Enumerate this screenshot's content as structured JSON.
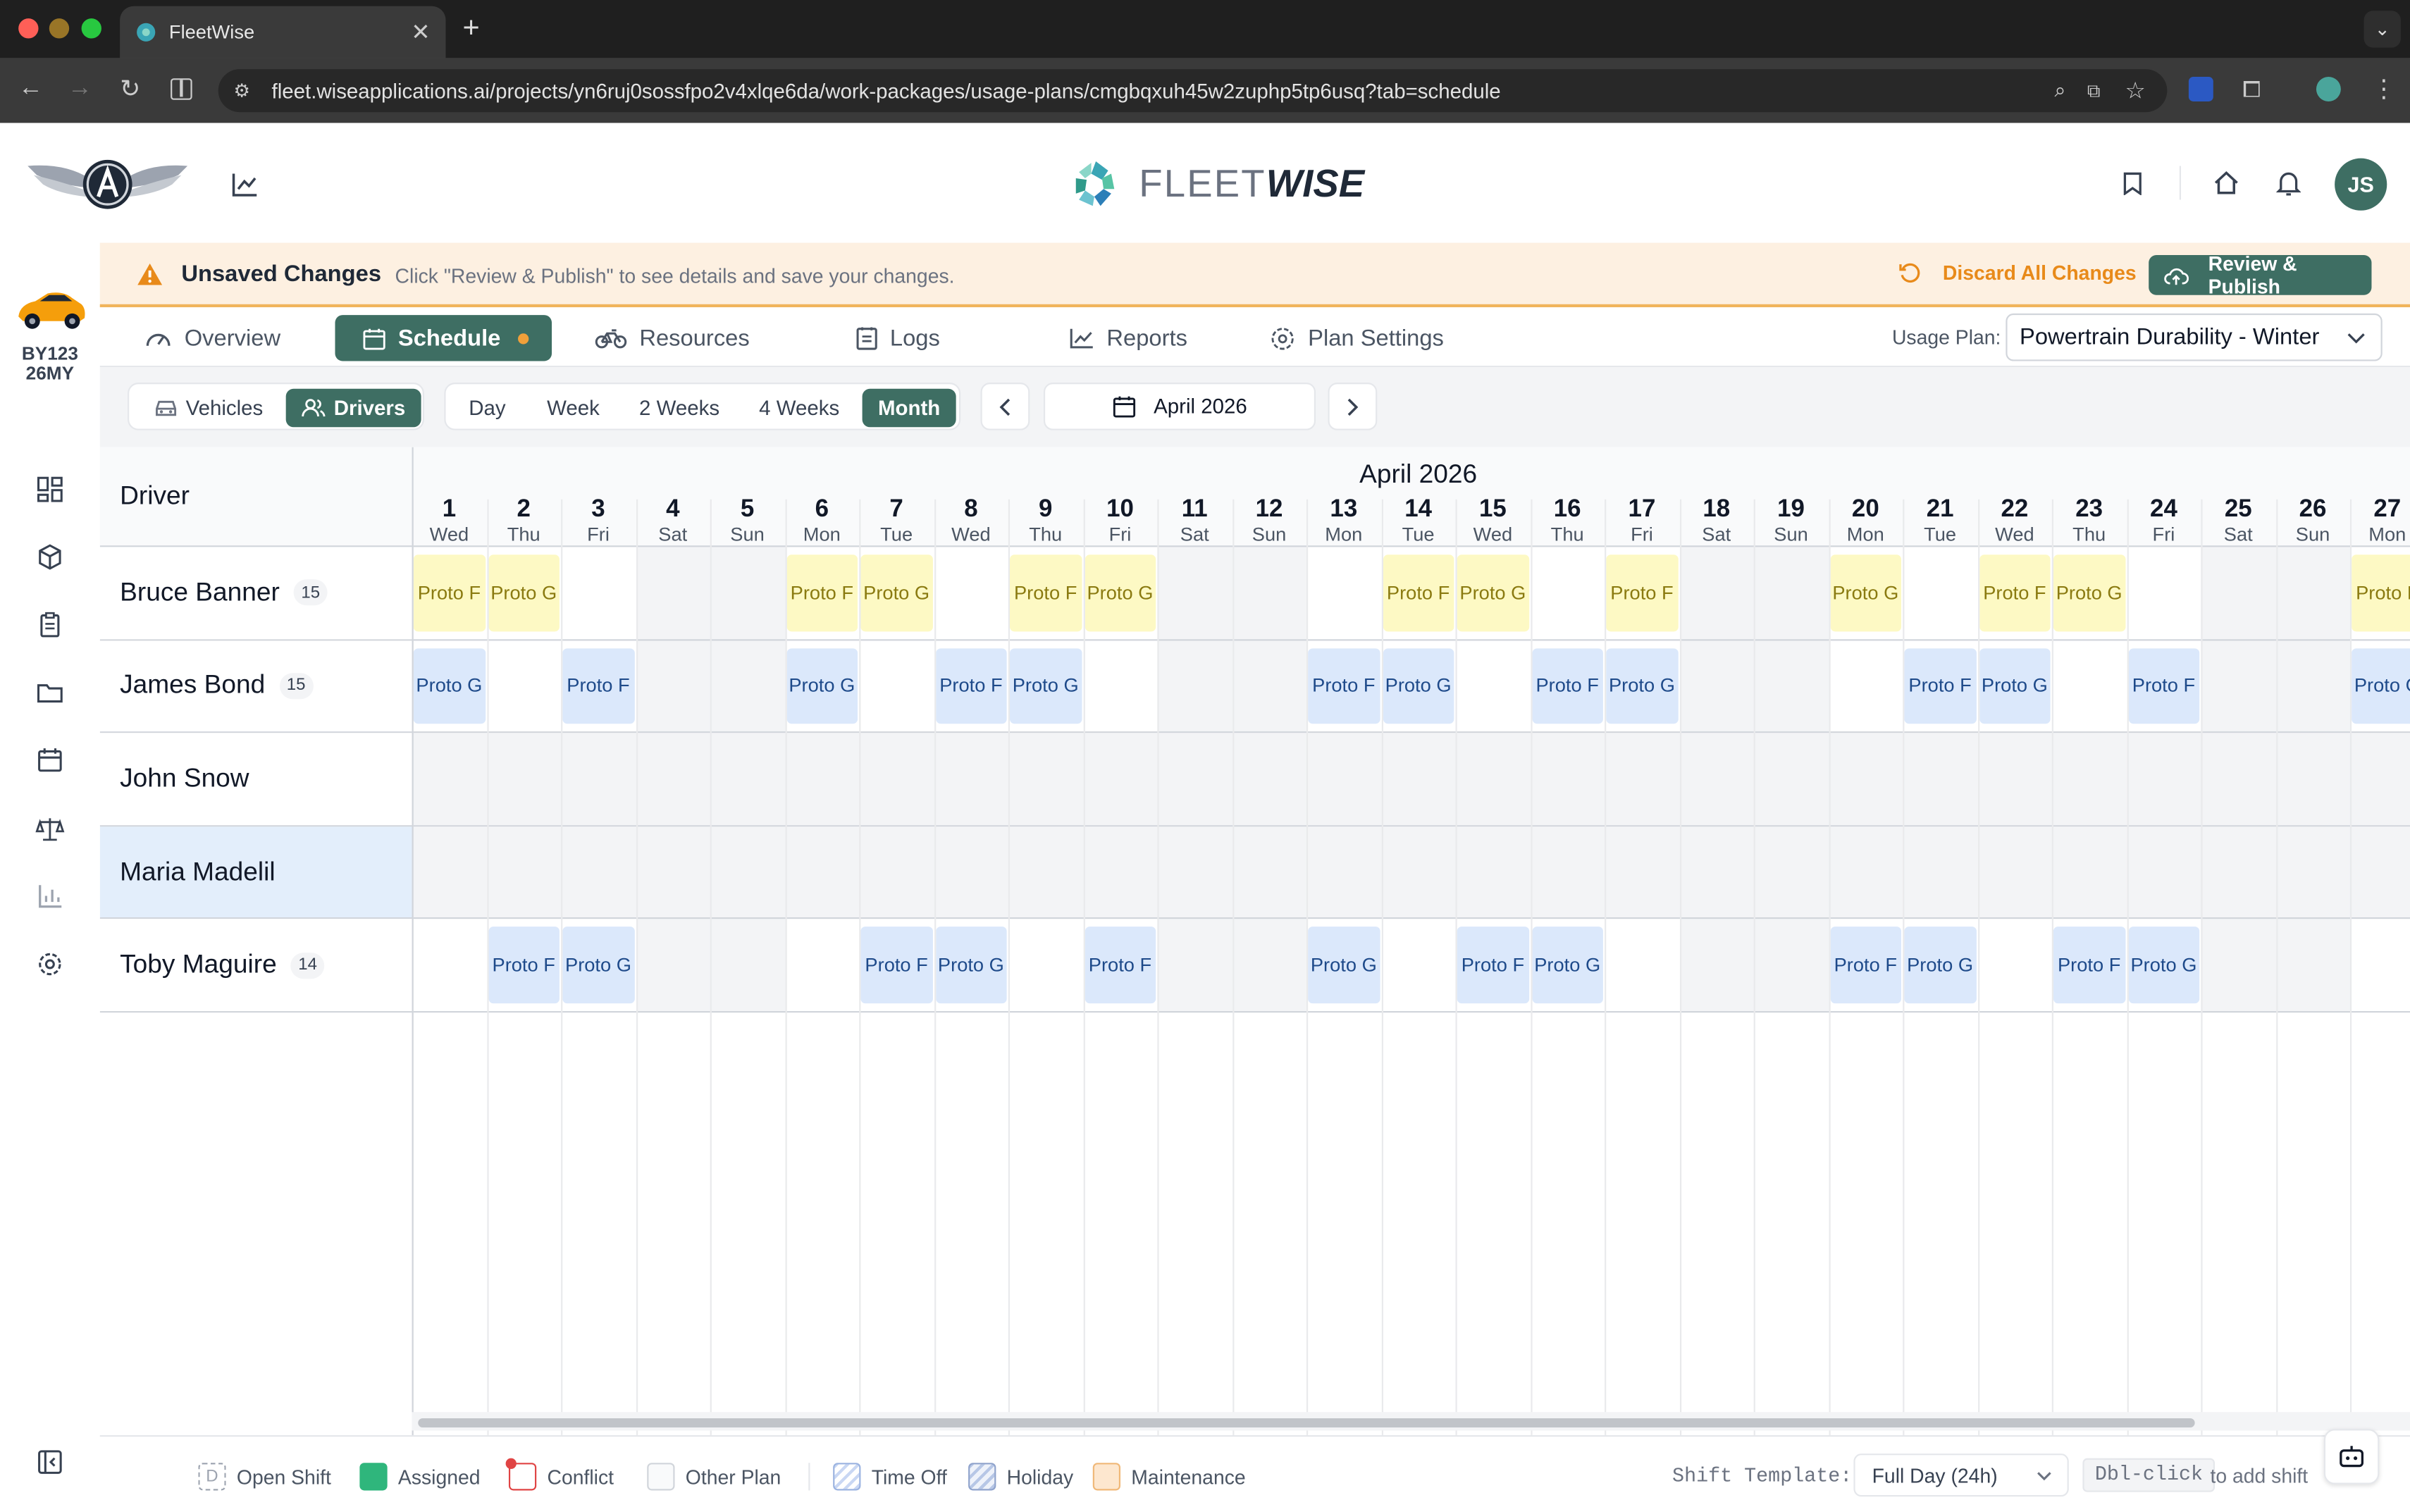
{
  "browser": {
    "tab_title": "FleetWise",
    "url": "fleet.wiseapplications.ai/projects/yn6ruj0sossfpo2v4xlqe6da/work-packages/usage-plans/cmgbqxuh45w2zuphp5tp6usq?tab=schedule"
  },
  "header": {
    "brand_light": "FLEET",
    "brand_bold": "WISE",
    "avatar_initials": "JS"
  },
  "vehicle": {
    "line1": "BY123",
    "line2": "26MY"
  },
  "banner": {
    "title": "Unsaved Changes",
    "message": "Click \"Review & Publish\" to see details and save your changes.",
    "discard_label": "Discard All Changes",
    "publish_label": "Review & Publish"
  },
  "nav": {
    "tabs": [
      "Overview",
      "Schedule",
      "Resources",
      "Logs",
      "Reports",
      "Plan Settings"
    ],
    "active": "Schedule",
    "usage_plan_label": "Usage Plan:",
    "usage_plan_value": "Powertrain Durability - Winter"
  },
  "toolbar": {
    "resource_types": [
      "Vehicles",
      "Drivers"
    ],
    "active_resource": "Drivers",
    "views": [
      "Day",
      "Week",
      "2 Weeks",
      "4 Weeks",
      "Month"
    ],
    "active_view": "Month",
    "period": "April 2026"
  },
  "schedule": {
    "month_label": "April 2026",
    "column_header": "Driver",
    "days": [
      {
        "n": "1",
        "d": "Wed"
      },
      {
        "n": "2",
        "d": "Thu"
      },
      {
        "n": "3",
        "d": "Fri"
      },
      {
        "n": "4",
        "d": "Sat"
      },
      {
        "n": "5",
        "d": "Sun"
      },
      {
        "n": "6",
        "d": "Mon"
      },
      {
        "n": "7",
        "d": "Tue"
      },
      {
        "n": "8",
        "d": "Wed"
      },
      {
        "n": "9",
        "d": "Thu"
      },
      {
        "n": "10",
        "d": "Fri"
      },
      {
        "n": "11",
        "d": "Sat"
      },
      {
        "n": "12",
        "d": "Sun"
      },
      {
        "n": "13",
        "d": "Mon"
      },
      {
        "n": "14",
        "d": "Tue"
      },
      {
        "n": "15",
        "d": "Wed"
      },
      {
        "n": "16",
        "d": "Thu"
      },
      {
        "n": "17",
        "d": "Fri"
      },
      {
        "n": "18",
        "d": "Sat"
      },
      {
        "n": "19",
        "d": "Sun"
      },
      {
        "n": "20",
        "d": "Mon"
      },
      {
        "n": "21",
        "d": "Tue"
      },
      {
        "n": "22",
        "d": "Wed"
      },
      {
        "n": "23",
        "d": "Thu"
      },
      {
        "n": "24",
        "d": "Fri"
      },
      {
        "n": "25",
        "d": "Sat"
      },
      {
        "n": "26",
        "d": "Sun"
      },
      {
        "n": "27",
        "d": "Mon"
      }
    ],
    "drivers": [
      {
        "name": "Bruce Banner",
        "count": "15",
        "selected": false,
        "shift_style": "other",
        "shifts": [
          [
            1,
            "Proto F"
          ],
          [
            2,
            "Proto G"
          ],
          [
            6,
            "Proto F"
          ],
          [
            7,
            "Proto G"
          ],
          [
            9,
            "Proto F"
          ],
          [
            10,
            "Proto G"
          ],
          [
            14,
            "Proto F"
          ],
          [
            15,
            "Proto G"
          ],
          [
            17,
            "Proto F"
          ],
          [
            20,
            "Proto G"
          ],
          [
            22,
            "Proto F"
          ],
          [
            23,
            "Proto G"
          ],
          [
            27,
            "Proto F"
          ]
        ]
      },
      {
        "name": "James Bond",
        "count": "15",
        "selected": false,
        "shift_style": "assigned",
        "shifts": [
          [
            1,
            "Proto G"
          ],
          [
            3,
            "Proto F"
          ],
          [
            6,
            "Proto G"
          ],
          [
            8,
            "Proto F"
          ],
          [
            9,
            "Proto G"
          ],
          [
            13,
            "Proto F"
          ],
          [
            14,
            "Proto G"
          ],
          [
            16,
            "Proto F"
          ],
          [
            17,
            "Proto G"
          ],
          [
            21,
            "Proto F"
          ],
          [
            22,
            "Proto G"
          ],
          [
            24,
            "Proto F"
          ],
          [
            27,
            "Proto G"
          ]
        ]
      },
      {
        "name": "John Snow",
        "count": "",
        "selected": false,
        "shift_style": "assigned",
        "shifts": []
      },
      {
        "name": "Maria Madelil",
        "count": "",
        "selected": true,
        "shift_style": "assigned",
        "shifts": []
      },
      {
        "name": "Toby Maguire",
        "count": "14",
        "selected": false,
        "shift_style": "assigned",
        "shifts": [
          [
            2,
            "Proto F"
          ],
          [
            3,
            "Proto G"
          ],
          [
            7,
            "Proto F"
          ],
          [
            8,
            "Proto G"
          ],
          [
            10,
            "Proto F"
          ],
          [
            13,
            "Proto G"
          ],
          [
            15,
            "Proto F"
          ],
          [
            16,
            "Proto G"
          ],
          [
            20,
            "Proto F"
          ],
          [
            21,
            "Proto G"
          ],
          [
            23,
            "Proto F"
          ],
          [
            24,
            "Proto G"
          ]
        ]
      }
    ]
  },
  "legend": {
    "items": [
      "Open Shift",
      "Assigned",
      "Conflict",
      "Other Plan",
      "Time Off",
      "Holiday",
      "Maintenance"
    ],
    "open_shift_glyph": "D",
    "shift_template_label": "Shift Template:",
    "shift_template_value": "Full Day (24h)",
    "hint_key": "Dbl-click",
    "hint_text": "to add shift"
  },
  "colors": {
    "accent": "#3e6e63",
    "assigned_bg": "#dbe8fb",
    "assigned_text": "#1e4a8a",
    "other_bg": "#fdf9c4",
    "other_text": "#8a7a10",
    "banner_bg": "#fdf0e1",
    "warning": "#e88a1a",
    "selected_row": "#e3eefb"
  },
  "icons": [
    "chart-icon",
    "bookmark-icon",
    "home-icon",
    "bell-icon",
    "dashboard-icon",
    "box-icon",
    "clipboard-icon",
    "folder-icon",
    "calendar-icon",
    "scale-icon",
    "bar-chart-icon",
    "settings-icon",
    "collapse-sidebar-icon",
    "warning-icon",
    "undo-icon",
    "cloud-upload-icon",
    "gauge-icon",
    "bike-icon",
    "logs-icon",
    "reports-icon",
    "chevron-left-icon",
    "chevron-right-icon",
    "car-icon",
    "users-icon",
    "bot-icon"
  ]
}
